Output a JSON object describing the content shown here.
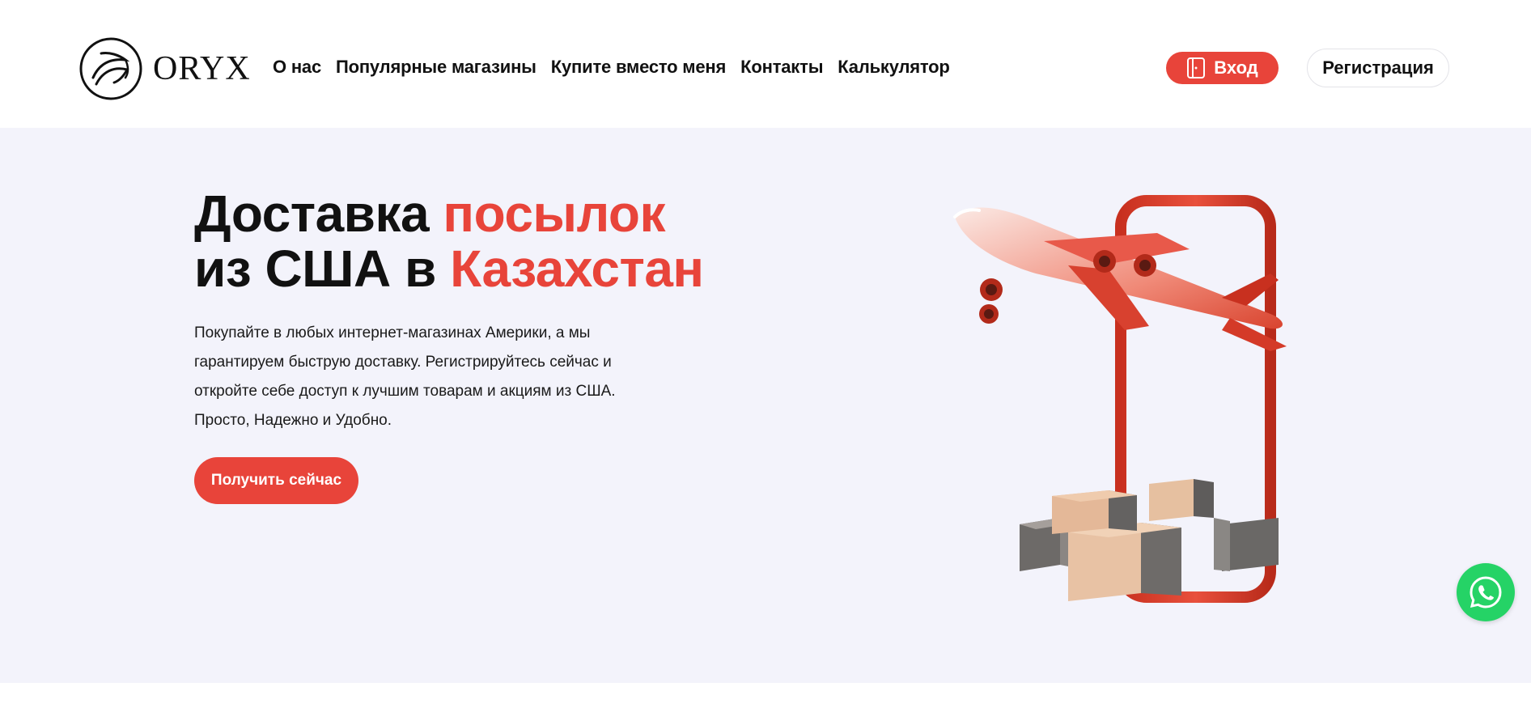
{
  "brand": {
    "name": "ORYX",
    "logo_icon": "oryx-head-logo"
  },
  "nav": {
    "items": [
      {
        "label": "О нас"
      },
      {
        "label": "Популярные магазины"
      },
      {
        "label": "Купите вместо меня"
      },
      {
        "label": "Контакты"
      },
      {
        "label": "Калькулятор"
      }
    ]
  },
  "auth": {
    "login_label": "Вход",
    "login_icon": "door-login-icon",
    "register_label": "Регистрация"
  },
  "hero": {
    "title_part1": "Доставка ",
    "title_accent1": "посылок",
    "title_part2": "из США в ",
    "title_accent2": "Казахстан",
    "description": "Покупайте в любых интернет-магазинах Америки, а мы гарантируем быструю доставку. Регистрируйтесь сейчас и откройте себе доступ к лучшим товарам и акциям из США. Просто, Надежно и Удобно.",
    "cta_label": "Получить сейчас",
    "illustration": "airplane-phone-boxes"
  },
  "floating": {
    "whatsapp_icon": "whatsapp-icon"
  },
  "colors": {
    "accent": "#e8443a",
    "hero_bg": "#f3f3fb",
    "whatsapp": "#25d366"
  }
}
